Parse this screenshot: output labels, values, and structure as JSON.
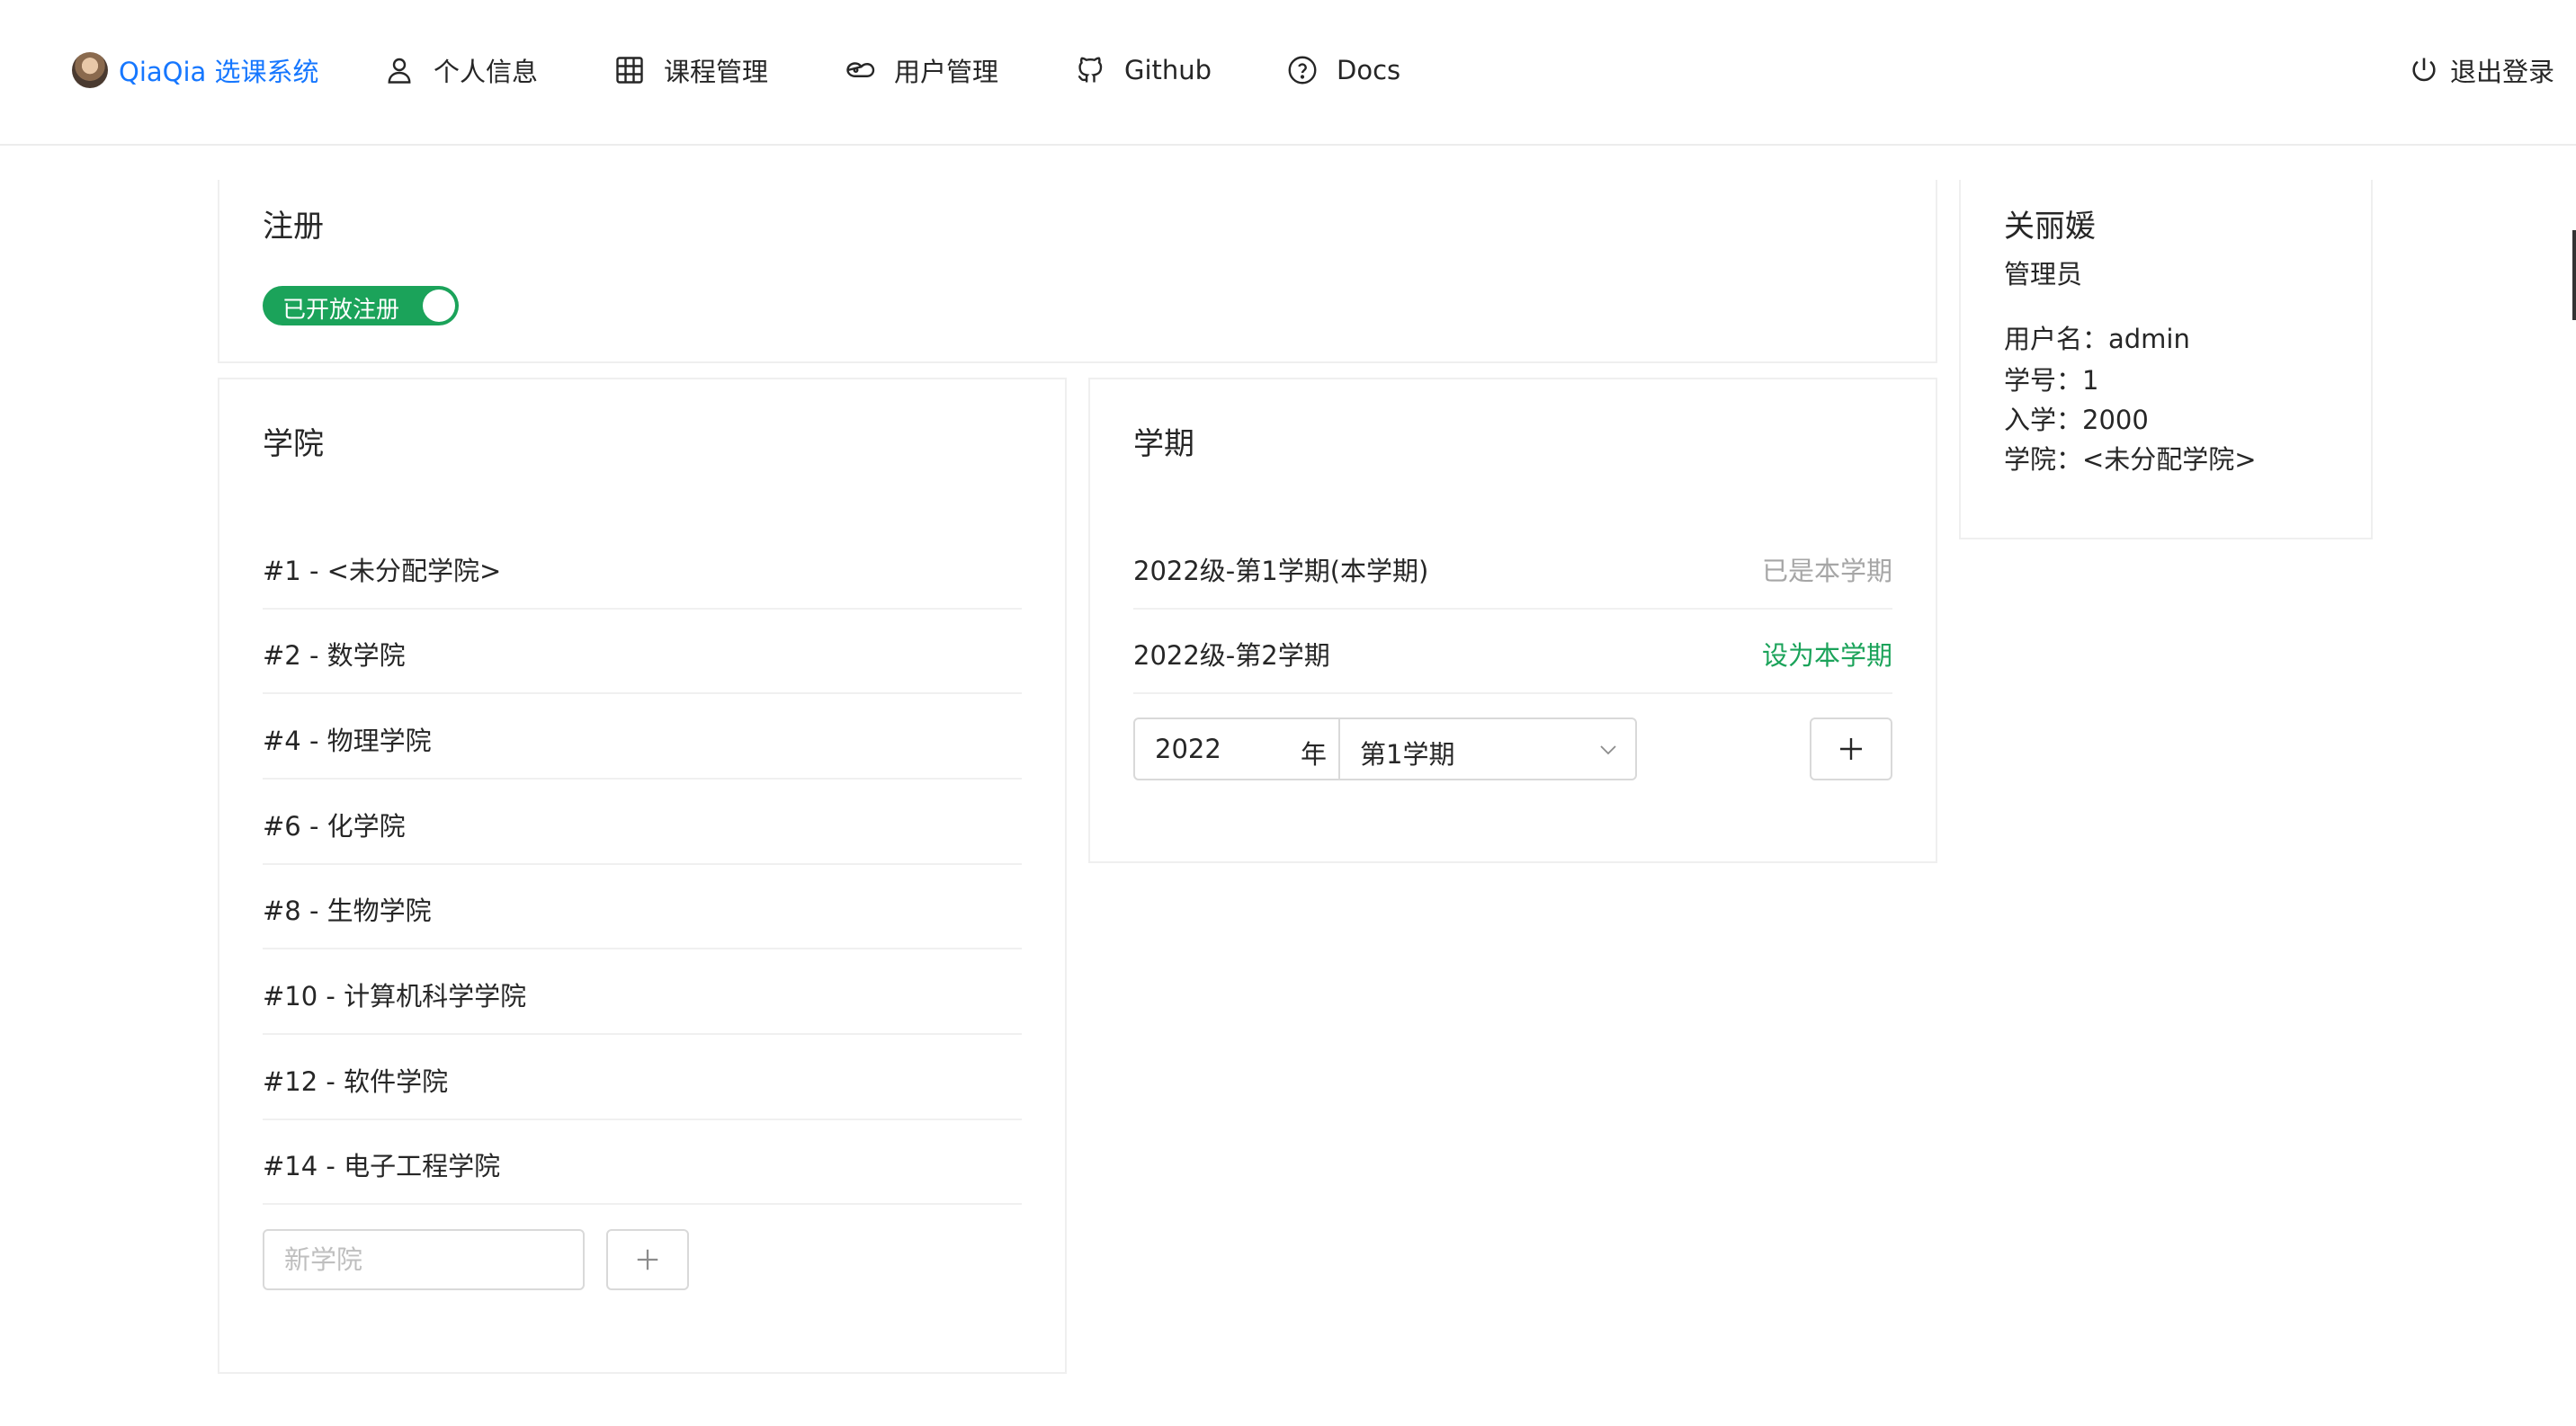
{
  "header": {
    "brand": "QiaQia 选课系统",
    "nav": [
      {
        "label": "个人信息",
        "icon": "user-icon"
      },
      {
        "label": "课程管理",
        "icon": "table-icon"
      },
      {
        "label": "用户管理",
        "icon": "users-icon"
      },
      {
        "label": "Github",
        "icon": "github-icon"
      },
      {
        "label": "Docs",
        "icon": "question-icon"
      }
    ],
    "logout": {
      "label": "退出登录",
      "icon": "power-icon"
    }
  },
  "registration": {
    "title": "注册",
    "toggle_label": "已开放注册",
    "enabled": true
  },
  "colleges": {
    "title": "学院",
    "items": [
      "#1 - <未分配学院>",
      "#2 - 数学院",
      "#4 - 物理学院",
      "#6 - 化学院",
      "#8 - 生物学院",
      "#10 - 计算机科学学院",
      "#12 - 软件学院",
      "#14 - 电子工程学院"
    ],
    "new_placeholder": "新学院",
    "add_icon": "plus-icon"
  },
  "semesters": {
    "title": "学期",
    "items": [
      {
        "name": "2022级-第1学期(本学期)",
        "action": "已是本学期",
        "action_color": "#a6a6a6"
      },
      {
        "name": "2022级-第2学期",
        "action": "设为本学期",
        "action_color": "#1ba35a"
      }
    ],
    "new_year": "2022",
    "year_suffix": "年",
    "new_semester": "第1学期",
    "add_icon": "plus-icon"
  },
  "profile": {
    "name": "关丽媛",
    "role": "管理员",
    "username": "用户名：admin",
    "student_id": "学号：1",
    "enrollment": "入学：2000",
    "college": "学院：<未分配学院>"
  },
  "colors": {
    "brand": "#1677ff",
    "accent_green": "#1ba35a",
    "muted": "#a6a6a6"
  }
}
